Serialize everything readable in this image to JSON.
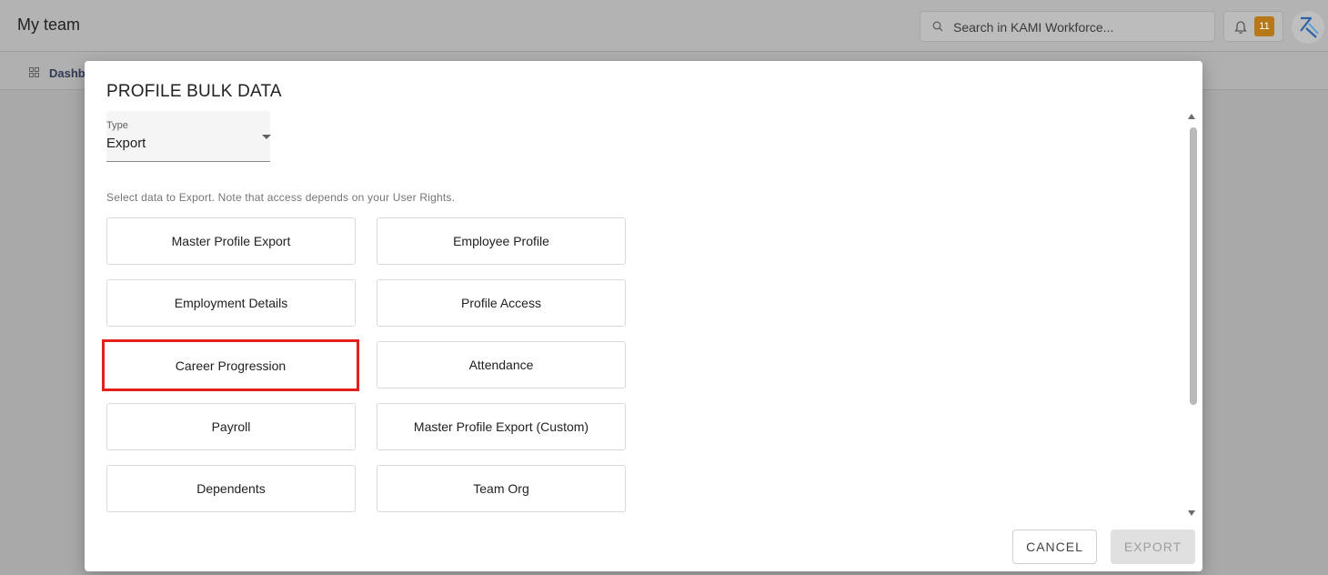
{
  "header": {
    "title": "My team",
    "search": {
      "placeholder": "Search in KAMI Workforce...",
      "icon": "search-icon"
    },
    "notifications": {
      "count": "11",
      "icon": "bell-icon"
    },
    "logo_icon": "kami-logo-icon"
  },
  "subnav": {
    "label": "Dashb",
    "icon": "grid-icon"
  },
  "modal": {
    "title": "PROFILE BULK DATA",
    "type_field": {
      "label": "Type",
      "value": "Export"
    },
    "hint": "Select data to Export. Note that access depends on your User Rights.",
    "options": [
      {
        "label": "Master Profile Export"
      },
      {
        "label": "Employee Profile"
      },
      {
        "label": "Employment Details"
      },
      {
        "label": "Profile Access"
      },
      {
        "label": "Career Progression",
        "highlighted": true
      },
      {
        "label": "Attendance"
      },
      {
        "label": "Payroll"
      },
      {
        "label": "Master Profile Export (Custom)"
      },
      {
        "label": "Dependents"
      },
      {
        "label": "Team Org"
      }
    ],
    "actions": {
      "cancel": "CANCEL",
      "export": "EXPORT"
    }
  },
  "colors": {
    "highlight": "#e3211c",
    "badge": "#b7781a",
    "accent": "#303a55"
  }
}
